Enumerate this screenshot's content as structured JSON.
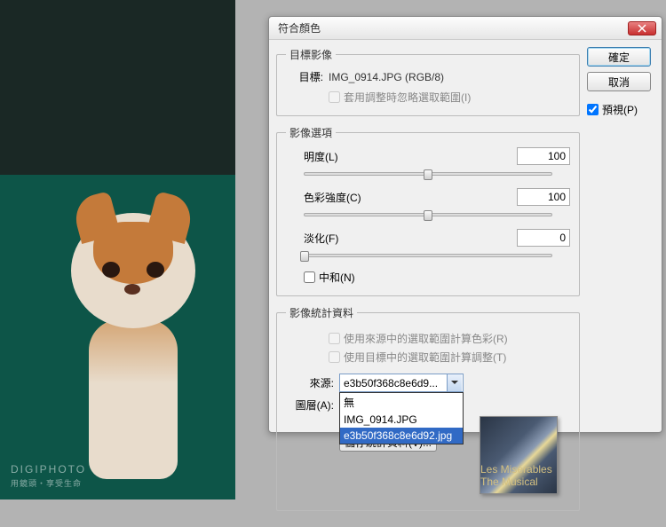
{
  "dialog": {
    "title": "符合顏色"
  },
  "target_group": {
    "legend": "目標影像",
    "label": "目標:",
    "value": "IMG_0914.JPG (RGB/8)",
    "ignore_selection": "套用調整時忽略選取範圍(I)"
  },
  "options_group": {
    "legend": "影像選項",
    "luminance": {
      "label": "明度(L)",
      "value": "100",
      "pos": 50
    },
    "intensity": {
      "label": "色彩強度(C)",
      "value": "100",
      "pos": 50
    },
    "fade": {
      "label": "淡化(F)",
      "value": "0",
      "pos": 0
    },
    "neutralize": "中和(N)"
  },
  "stats_group": {
    "legend": "影像統計資料",
    "use_source_selection": "使用來源中的選取範圍計算色彩(R)",
    "use_target_selection": "使用目標中的選取範圍計算調整(T)",
    "source_label": "來源:",
    "layer_label": "圖層(A):",
    "save_stats": "儲存統計資料(V)..."
  },
  "dropdown": {
    "selected": "e3b50f368c8e6d9...",
    "items": [
      "無",
      "IMG_0914.JPG",
      "e3b50f368c8e6d92.jpg"
    ]
  },
  "buttons": {
    "ok": "確定",
    "cancel": "取消",
    "preview": "預視(P)"
  },
  "watermark": {
    "main": "DIGIPHOTO",
    "sub": "用鏡頭‧享受生命"
  },
  "thumb_caption": "Les Misérables The Musical"
}
